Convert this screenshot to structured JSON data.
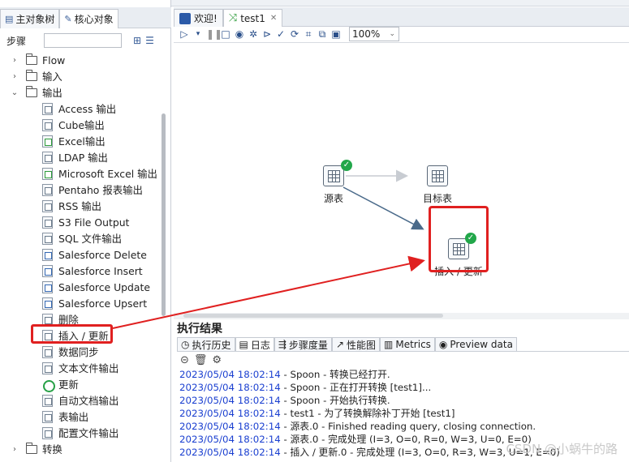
{
  "left_tabs": [
    {
      "label": "主对象树"
    },
    {
      "label": "核心对象"
    }
  ],
  "steps_label": "步骤",
  "tree": {
    "folders_top": [
      {
        "label": "Flow"
      },
      {
        "label": "输入"
      },
      {
        "label": "输出"
      }
    ],
    "output_children": [
      {
        "label": "Access 输出"
      },
      {
        "label": "Cube输出"
      },
      {
        "label": "Excel输出"
      },
      {
        "label": "LDAP 输出"
      },
      {
        "label": "Microsoft Excel 输出"
      },
      {
        "label": "Pentaho 报表输出"
      },
      {
        "label": "RSS 输出"
      },
      {
        "label": "S3 File Output"
      },
      {
        "label": "SQL 文件输出"
      },
      {
        "label": "Salesforce Delete"
      },
      {
        "label": "Salesforce Insert"
      },
      {
        "label": "Salesforce Update"
      },
      {
        "label": "Salesforce Upsert"
      },
      {
        "label": "删除"
      },
      {
        "label": "插入 / 更新"
      },
      {
        "label": "数据同步"
      },
      {
        "label": "文本文件输出"
      },
      {
        "label": "更新"
      },
      {
        "label": "自动文档输出"
      },
      {
        "label": "表输出"
      },
      {
        "label": "配置文件输出"
      }
    ],
    "folders_bottom": [
      {
        "label": "转换"
      }
    ]
  },
  "editor_tabs": [
    {
      "label": "欢迎!"
    },
    {
      "label": "test1"
    }
  ],
  "toolbar": {
    "zoom": "100%"
  },
  "canvas": {
    "nodes": [
      {
        "label": "源表"
      },
      {
        "label": "目标表"
      },
      {
        "label": "插入 / 更新"
      }
    ]
  },
  "results": {
    "title": "执行结果",
    "tabs": [
      {
        "label": "执行历史"
      },
      {
        "label": "日志"
      },
      {
        "label": "步骤度量"
      },
      {
        "label": "性能图"
      },
      {
        "label": "Metrics"
      },
      {
        "label": "Preview data"
      }
    ],
    "log": [
      {
        "ts": "2023/05/04 18:02:14",
        "msg": " - Spoon - 转换已经打开."
      },
      {
        "ts": "2023/05/04 18:02:14",
        "msg": " - Spoon - 正在打开转换 [test1]..."
      },
      {
        "ts": "2023/05/04 18:02:14",
        "msg": " - Spoon - 开始执行转换."
      },
      {
        "ts": "2023/05/04 18:02:14",
        "msg": " - test1 - 为了转换解除补丁开始  [test1]"
      },
      {
        "ts": "2023/05/04 18:02:14",
        "msg": " - 源表.0 - Finished reading query, closing connection."
      },
      {
        "ts": "2023/05/04 18:02:14",
        "msg": " - 源表.0 - 完成处理 (I=3, O=0, R=0, W=3, U=0, E=0)"
      },
      {
        "ts": "2023/05/04 18:02:14",
        "msg": " - 插入 / 更新.0 - 完成处理 (I=3, O=0, R=3, W=3, U=1, E=0)"
      }
    ]
  },
  "watermark": "CSDN @小蜗牛的路",
  "colors": {
    "highlight": "#e02020",
    "success": "#22a74a",
    "log_timestamp": "#1a3fd0"
  }
}
